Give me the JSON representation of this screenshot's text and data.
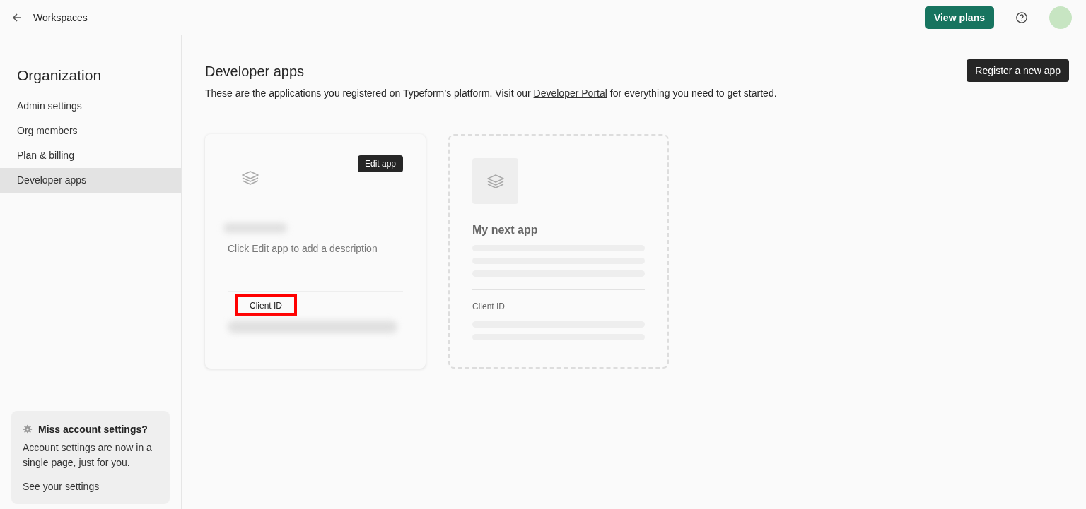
{
  "topbar": {
    "back_label": "Workspaces",
    "plans_button": "View plans"
  },
  "sidebar": {
    "title": "Organization",
    "items": [
      {
        "label": "Admin settings",
        "selected": false
      },
      {
        "label": "Org members",
        "selected": false
      },
      {
        "label": "Plan & billing",
        "selected": false
      },
      {
        "label": "Developer apps",
        "selected": true
      }
    ],
    "notice": {
      "title": "Miss account settings?",
      "text": "Account settings are now in a single page, just for you.",
      "link": "See your settings"
    }
  },
  "main": {
    "title": "Developer apps",
    "register_button": "Register a new app",
    "intro_before": "These are the applications you registered on Typeform’s platform. Visit our ",
    "intro_link": "Developer Portal",
    "intro_after": " for everything you need to get started.",
    "apps": [
      {
        "kind": "app",
        "edit_button": "Edit app",
        "description": "Click Edit app to add a description",
        "client_id_label": "Client ID",
        "highlighted": true
      },
      {
        "kind": "placeholder",
        "name": "My next app",
        "client_id_label": "Client ID"
      }
    ]
  }
}
